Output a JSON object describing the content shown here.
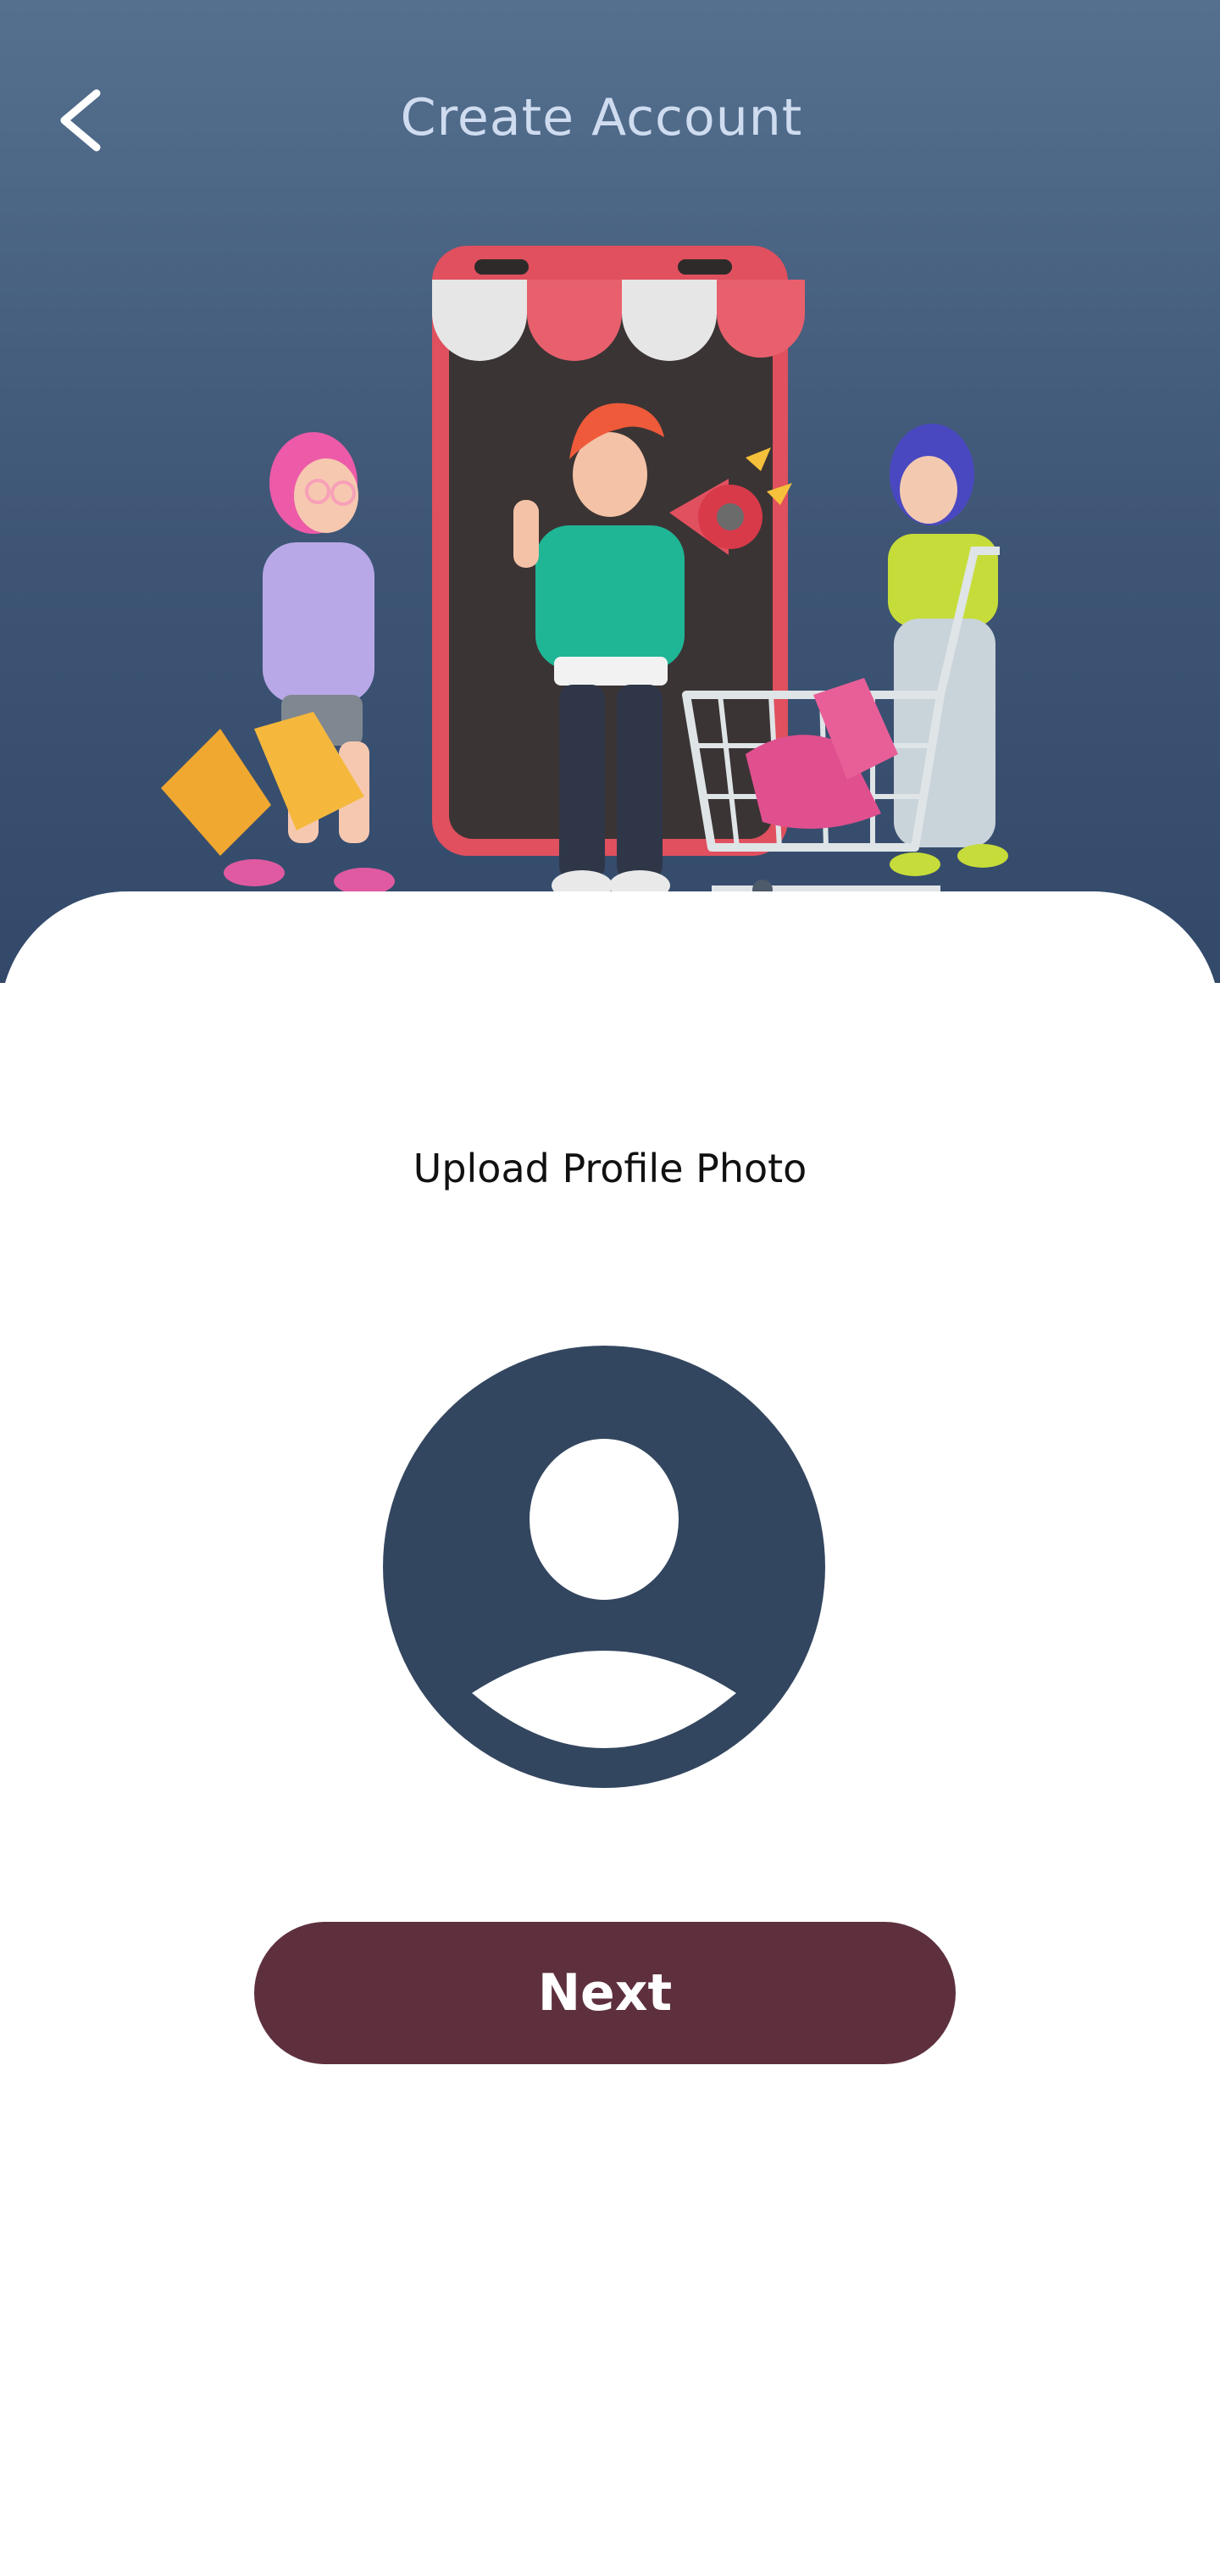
{
  "header": {
    "title": "Create Account",
    "back_icon": "chevron-left-icon",
    "background_colors": [
      "#55708f",
      "#33496a"
    ]
  },
  "illustration": {
    "description_icon": "shopping-illustration"
  },
  "main": {
    "upload_label": "Upload Profile Photo",
    "avatar_icon": "user-placeholder-icon",
    "avatar_color": "#33465f",
    "next_label": "Next",
    "next_color": "#5e303e"
  }
}
